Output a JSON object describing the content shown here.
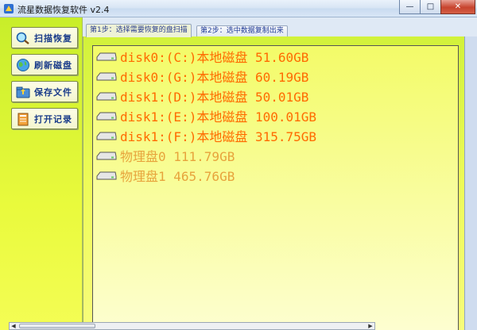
{
  "window": {
    "title": "流星数据恢复软件 v2.4",
    "controls": {
      "minimize": "—",
      "maximize": "□",
      "close": "✕"
    }
  },
  "sidebar": {
    "buttons": [
      {
        "label": "扫描恢复",
        "icon": "magnify-scan-icon"
      },
      {
        "label": "刷新磁盘",
        "icon": "globe-refresh-icon"
      },
      {
        "label": "保存文件",
        "icon": "save-folder-icon"
      },
      {
        "label": "打开记录",
        "icon": "notebook-icon"
      }
    ]
  },
  "tabs": [
    {
      "label": "第1步：选择需要恢复的盘扫描",
      "active": true
    },
    {
      "label": "第2步：选中数据复制出来",
      "active": false
    }
  ],
  "disks": [
    {
      "label": "disk0:(C:)本地磁盘 51.60GB",
      "style": "partition"
    },
    {
      "label": "disk0:(G:)本地磁盘 60.19GB",
      "style": "partition"
    },
    {
      "label": "disk1:(D:)本地磁盘 50.01GB",
      "style": "partition"
    },
    {
      "label": "disk1:(E:)本地磁盘 100.01GB",
      "style": "partition"
    },
    {
      "label": "disk1:(F:)本地磁盘 315.75GB",
      "style": "partition"
    },
    {
      "label": "物理盘0 111.79GB",
      "style": "physical"
    },
    {
      "label": "物理盘1 465.76GB",
      "style": "physical"
    }
  ],
  "scrollbar": {
    "left_arrow": "◀",
    "right_arrow": "▶"
  },
  "colors": {
    "partition_text": "#ff6a00",
    "physical_text": "#e7a33c",
    "tab_text": "#1f3a96",
    "sidebar_label": "#1a3c8a"
  }
}
